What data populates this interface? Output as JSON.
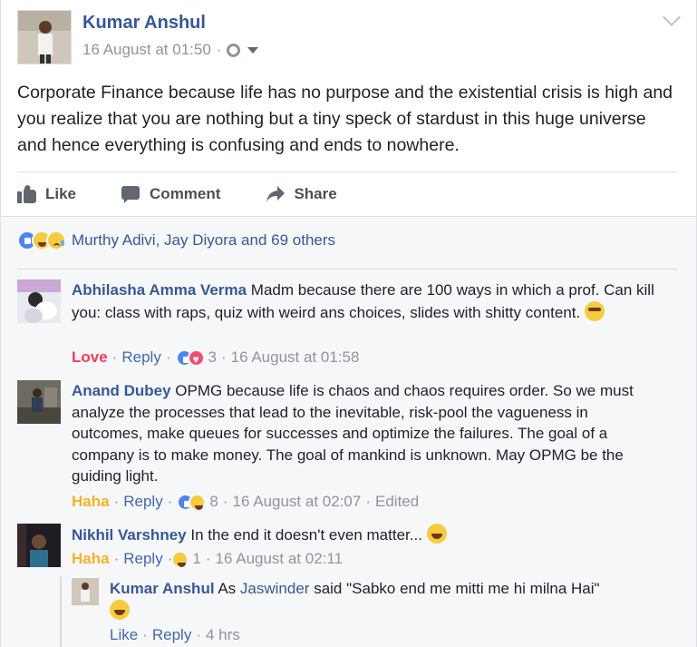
{
  "post": {
    "author": "Kumar Anshul",
    "timestamp": "16 August at 01:50",
    "meta_sep": "·",
    "privacy_icon": "globe-icon",
    "text": "Corporate Finance because life has no purpose and the existential crisis is high and you realize that you are nothing but a tiny speck of stardust in this huge universe and hence everything is confusing and ends to nowhere."
  },
  "actions": {
    "like": "Like",
    "comment": "Comment",
    "share": "Share"
  },
  "reactions": {
    "icons": [
      "like-reaction-icon",
      "haha-reaction-icon",
      "sad-reaction-icon"
    ],
    "names": "Murthy Adivi, Jay Diyora and 69 others"
  },
  "comments": [
    {
      "author": "Abhilasha Amma Verma",
      "text": "Madm because there are 100 ways in which a prof. Can kill you: class with raps, quiz with weird ans choices, slides with shitty content.",
      "reaction_label": "Love",
      "reply": "Reply",
      "count": "3",
      "time": "16 August at 01:58",
      "sep": "·"
    },
    {
      "author": "Anand Dubey",
      "text": "OPMG because life is chaos and chaos requires order. So we must analyze the processes that lead to the inevitable, risk-pool the vagueness in outcomes, make queues for successes and optimize the failures. The goal of a company is to make money. The goal of mankind is unknown. May OPMG be the guiding light.",
      "reaction_label": "Haha",
      "reply": "Reply",
      "count": "8",
      "time": "16 August at 02:07",
      "edited": "Edited",
      "sep": "·"
    },
    {
      "author": "Nikhil Varshney",
      "text": "In the end it doesn't even matter...",
      "reaction_label": "Haha",
      "reply": "Reply",
      "count": "1",
      "time": "16 August at 02:11",
      "sep": "·"
    }
  ],
  "reply": {
    "author": "Kumar Anshul",
    "text_before": "As",
    "mention": "Jaswinder",
    "text_after": "said \"Sabko end me mitti me hi milna Hai\"",
    "like": "Like",
    "reply": "Reply",
    "time": "4 hrs",
    "sep": "·"
  },
  "colors": {
    "link": "#365899",
    "action_link": "#4267b2",
    "meta": "#90949c",
    "love": "#f33e58",
    "haha": "#f7b125"
  }
}
